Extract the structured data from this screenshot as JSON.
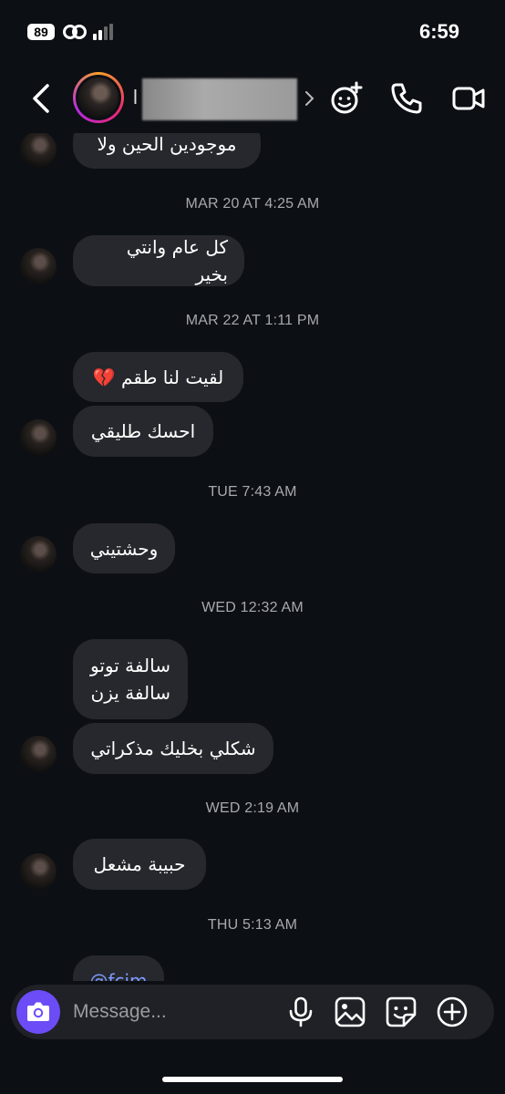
{
  "status_bar": {
    "battery": "89",
    "time": "6:59"
  },
  "header": {
    "contact_initial": "l"
  },
  "messages": [
    {
      "kind": "bubble",
      "text": "موجودين الحين ولا",
      "avatar": true
    },
    {
      "kind": "stamp",
      "text": "MAR 20 AT 4:25 AM"
    },
    {
      "kind": "bubble",
      "text": "كل عام وانتي بخير",
      "avatar": true
    },
    {
      "kind": "stamp",
      "text": "MAR 22 AT 1:11 PM"
    },
    {
      "kind": "bubble",
      "text": "لقيت لنا طقم 💔",
      "avatar": false
    },
    {
      "kind": "bubble",
      "text": "احسك طليقي",
      "avatar": true
    },
    {
      "kind": "stamp",
      "text": "TUE 7:43 AM"
    },
    {
      "kind": "bubble",
      "text": "وحشتيني",
      "avatar": true
    },
    {
      "kind": "stamp",
      "text": "WED 12:32 AM"
    },
    {
      "kind": "bubble",
      "text": "سالفة توتو\nسالفة يزن",
      "avatar": false
    },
    {
      "kind": "bubble",
      "text": "شكلي بخليك مذكراتي",
      "avatar": true
    },
    {
      "kind": "stamp",
      "text": "WED 2:19 AM"
    },
    {
      "kind": "bubble",
      "text": "حبيبة مشعل",
      "avatar": true
    },
    {
      "kind": "stamp",
      "text": "THU 5:13 AM"
    },
    {
      "kind": "bubble",
      "text": "@fcim",
      "avatar": false,
      "mention": true
    }
  ],
  "composer": {
    "placeholder": "Message..."
  },
  "colors": {
    "accent": "#6b4cf6",
    "bubble": "#26282d",
    "background": "#0c0f14",
    "mention": "#7e9cff"
  },
  "icons": [
    "back-icon",
    "chevron-right-icon",
    "effects-icon",
    "phone-icon",
    "video-icon",
    "camera-icon",
    "microphone-icon",
    "gallery-icon",
    "sticker-icon",
    "plus-icon"
  ]
}
